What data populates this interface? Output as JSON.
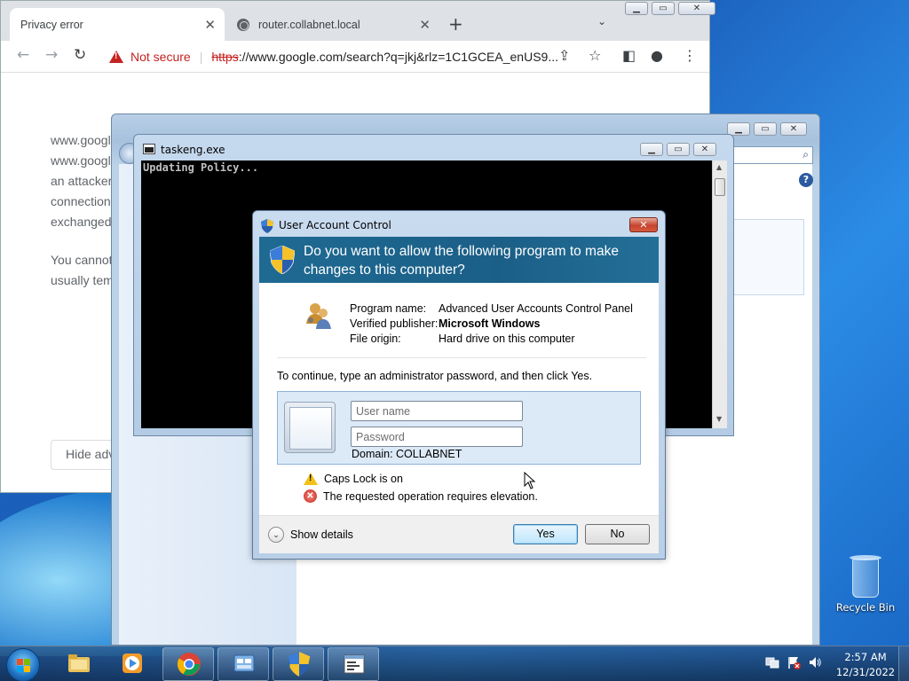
{
  "chrome": {
    "tabs": [
      {
        "title": "Privacy error"
      },
      {
        "title": "router.collabnet.local"
      }
    ],
    "security_label": "Not secure",
    "url_scheme": "https",
    "url_rest": "://www.google.com/search?q=jkj&rlz=1C1GCEA_enUS9...",
    "page_lines": [
      "www.googl",
      "www.googl",
      "an attacker",
      "connection",
      "exchanged."
    ],
    "page_lines2": [
      "You cannot",
      "usually tem"
    ],
    "hide_button": "Hide adv"
  },
  "console": {
    "title": "taskeng.exe",
    "output": "Updating Policy..."
  },
  "uac": {
    "title": "User Account Control",
    "question": "Do you want to allow the following program to make changes to this computer?",
    "labels": {
      "program": "Program name:",
      "publisher": "Verified publisher:",
      "origin": "File origin:"
    },
    "values": {
      "program": "Advanced User Accounts Control Panel",
      "publisher": "Microsoft Windows",
      "origin": "Hard drive on this computer"
    },
    "instruction": "To continue, type an administrator password, and then click Yes.",
    "username_placeholder": "User name",
    "password_placeholder": "Password",
    "domain": "Domain: COLLABNET",
    "caps_lock": "Caps Lock is on",
    "error": "The requested operation requires elevation.",
    "show_details": "Show details",
    "yes": "Yes",
    "no": "No"
  },
  "desktop": {
    "recycle_bin": "Recycle Bin"
  },
  "taskbar": {
    "time": "2:57 AM",
    "date": "12/31/2022"
  }
}
